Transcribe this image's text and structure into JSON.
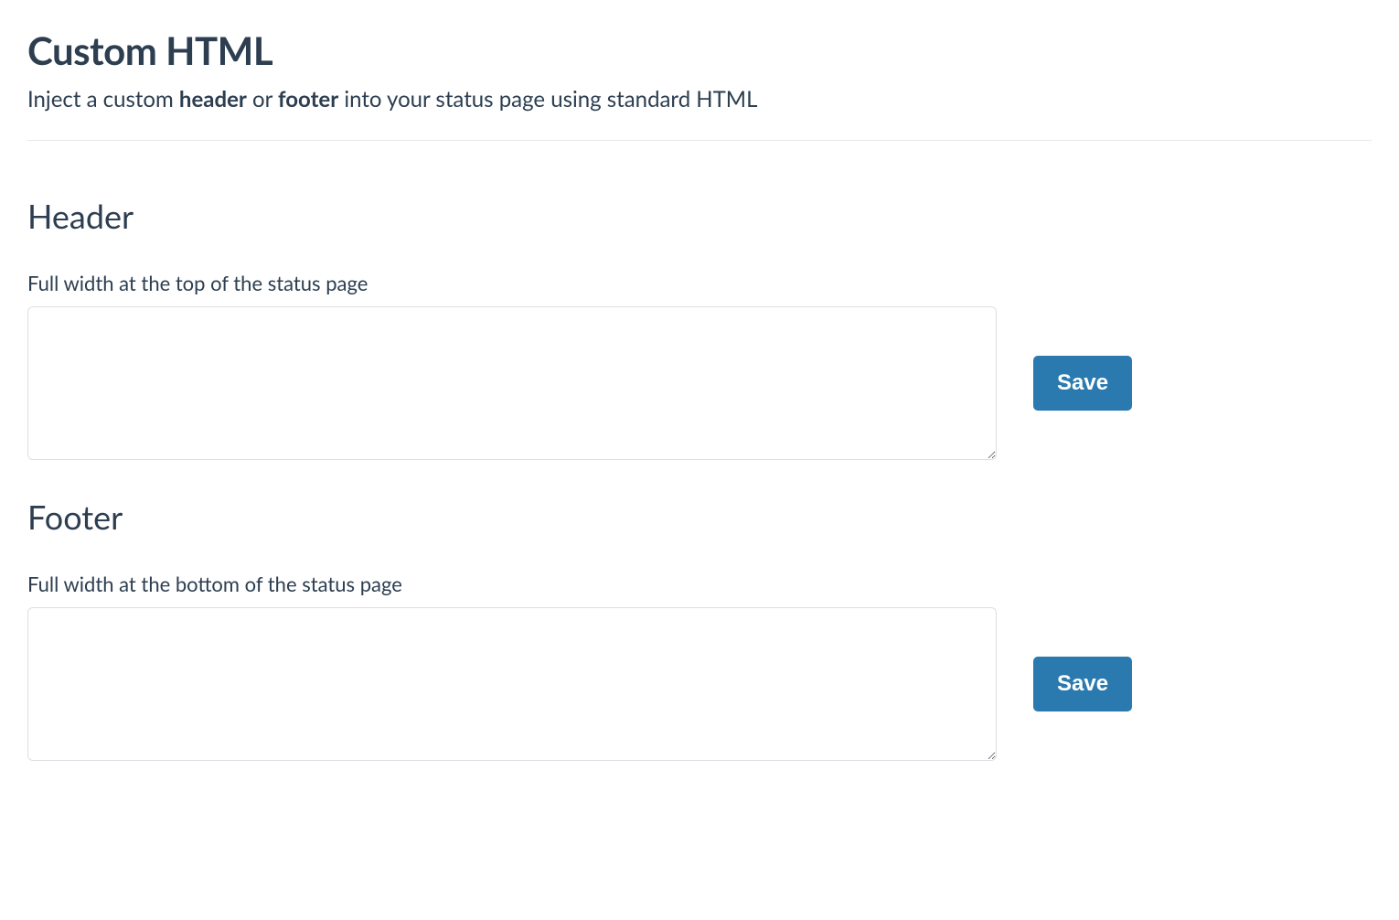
{
  "title": "Custom HTML",
  "subtitle": {
    "prefix": "Inject a custom ",
    "bold1": "header",
    "mid": " or ",
    "bold2": "footer",
    "suffix": " into your status page using standard HTML"
  },
  "header_section": {
    "heading": "Header",
    "label": "Full width at the top of the status page",
    "value": "",
    "save_label": "Save"
  },
  "footer_section": {
    "heading": "Footer",
    "label": "Full width at the bottom of the status page",
    "value": "",
    "save_label": "Save"
  }
}
